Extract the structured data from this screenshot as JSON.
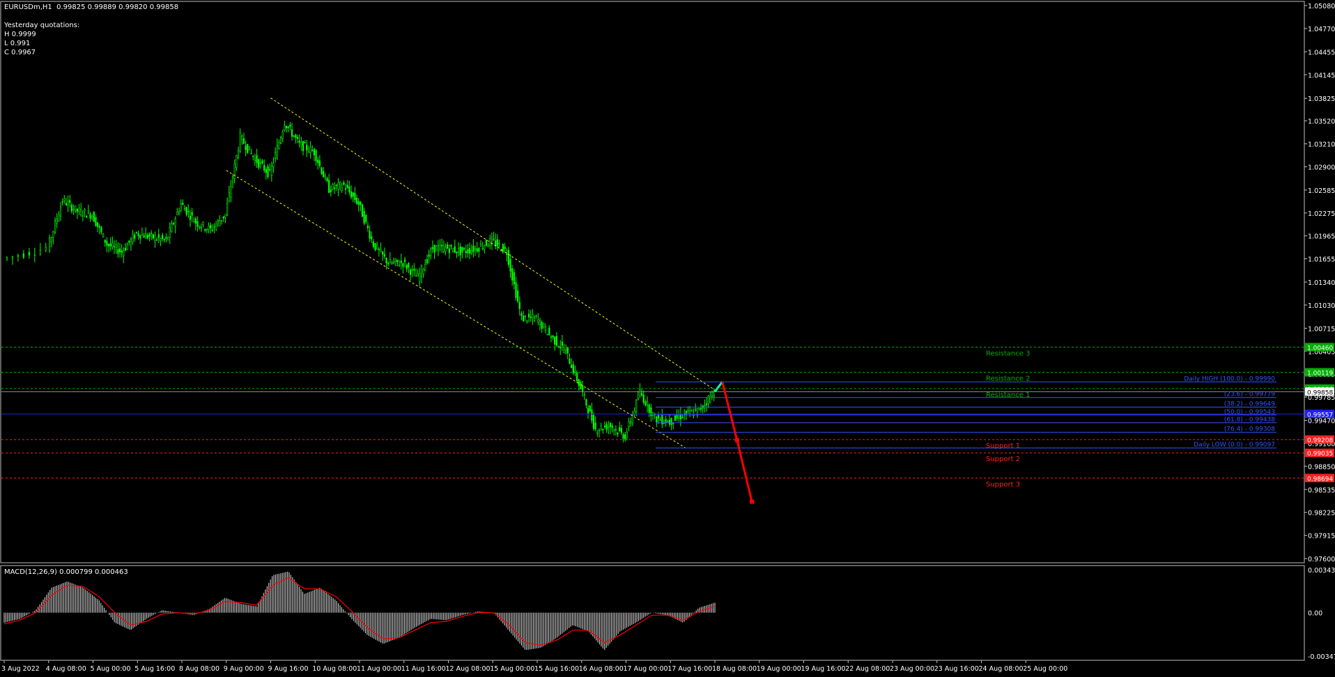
{
  "header": {
    "symbol_line": "EURUSDm,H1  0.99825 0.99889 0.99820 0.99858",
    "yesterday_title": "Yesterday quotations:",
    "high": "H 0.9999",
    "low": "L 0.991",
    "close": "C 0.9967"
  },
  "colors": {
    "background": "#000000",
    "candle": "#00ff00",
    "channel": "#ffff00",
    "resistance": "#00b000",
    "support": "#ff2020",
    "fib": "#3355ff",
    "forecast_up": "#00ffaa",
    "forecast_down": "#ff0000",
    "macd_hist": "#c0c0c0",
    "macd_signal": "#ff0000"
  },
  "price_axis": {
    "min": 0.976,
    "max": 1.0508,
    "ticks": [
      "1.05080",
      "1.04770",
      "1.04455",
      "1.04145",
      "1.03825",
      "1.03520",
      "1.03210",
      "1.02900",
      "1.02585",
      "1.02275",
      "1.01965",
      "1.01655",
      "1.01340",
      "1.01030",
      "1.00715",
      "1.00405",
      "1.00095",
      "0.99785",
      "0.99470",
      "0.99160",
      "0.98850",
      "0.98535",
      "0.98225",
      "0.97915",
      "0.97600"
    ]
  },
  "time_axis": {
    "labels": [
      "3 Aug 2022",
      "4 Aug 08:00",
      "5 Aug 00:00",
      "5 Aug 16:00",
      "8 Aug 08:00",
      "9 Aug 00:00",
      "9 Aug 16:00",
      "10 Aug 08:00",
      "11 Aug 00:00",
      "11 Aug 16:00",
      "12 Aug 08:00",
      "15 Aug 00:00",
      "15 Aug 16:00",
      "16 Aug 08:00",
      "17 Aug 00:00",
      "17 Aug 16:00",
      "18 Aug 08:00",
      "19 Aug 00:00",
      "19 Aug 16:00",
      "22 Aug 08:00",
      "23 Aug 00:00",
      "23 Aug 16:00",
      "24 Aug 08:00",
      "25 Aug 00:00"
    ]
  },
  "chart_data": {
    "type": "candlestick",
    "symbol": "EURUSDm",
    "timeframe": "H1",
    "close_path": [
      [
        "3 Aug 2022",
        1.0165
      ],
      [
        "4 Aug 00:00",
        1.018
      ],
      [
        "4 Aug 08:00",
        1.0245
      ],
      [
        "4 Aug 16:00",
        1.023
      ],
      [
        "5 Aug 00:00",
        1.0225
      ],
      [
        "5 Aug 08:00",
        1.0185
      ],
      [
        "5 Aug 16:00",
        1.0175
      ],
      [
        "8 Aug 00:00",
        1.02
      ],
      [
        "8 Aug 08:00",
        1.0195
      ],
      [
        "8 Aug 16:00",
        1.019
      ],
      [
        "9 Aug 00:00",
        1.024
      ],
      [
        "9 Aug 08:00",
        1.0215
      ],
      [
        "9 Aug 16:00",
        1.0205
      ],
      [
        "10 Aug 00:00",
        1.0225
      ],
      [
        "10 Aug 08:00",
        1.033
      ],
      [
        "10 Aug 16:00",
        1.03
      ],
      [
        "11 Aug 00:00",
        1.028
      ],
      [
        "11 Aug 08:00",
        1.035
      ],
      [
        "11 Aug 16:00",
        1.032
      ],
      [
        "12 Aug 00:00",
        1.031
      ],
      [
        "12 Aug 08:00",
        1.026
      ],
      [
        "12 Aug 16:00",
        1.0265
      ],
      [
        "15 Aug 00:00",
        1.024
      ],
      [
        "15 Aug 08:00",
        1.0185
      ],
      [
        "15 Aug 16:00",
        1.016
      ],
      [
        "16 Aug 00:00",
        1.016
      ],
      [
        "16 Aug 08:00",
        1.014
      ],
      [
        "16 Aug 16:00",
        1.018
      ],
      [
        "17 Aug 00:00",
        1.018
      ],
      [
        "17 Aug 08:00",
        1.0175
      ],
      [
        "17 Aug 16:00",
        1.018
      ],
      [
        "18 Aug 00:00",
        1.019
      ],
      [
        "18 Aug 08:00",
        1.0175
      ],
      [
        "18 Aug 16:00",
        1.0085
      ],
      [
        "19 Aug 00:00",
        1.0085
      ],
      [
        "19 Aug 08:00",
        1.006
      ],
      [
        "19 Aug 16:00",
        1.004
      ],
      [
        "22 Aug 00:00",
        0.999
      ],
      [
        "22 Aug 08:00",
        0.9935
      ],
      [
        "22 Aug 16:00",
        0.994
      ],
      [
        "23 Aug 00:00",
        0.9925
      ],
      [
        "23 Aug 08:00",
        0.9985
      ],
      [
        "23 Aug 16:00",
        0.995
      ],
      [
        "24 Aug 00:00",
        0.9945
      ],
      [
        "24 Aug 08:00",
        0.9955
      ],
      [
        "24 Aug 16:00",
        0.996
      ],
      [
        "25 Aug 00:00",
        0.9986
      ]
    ],
    "channel_lines": [
      {
        "from": [
          "11 Aug 00:00",
          1.0383
        ],
        "to": [
          "25 Aug 00:00",
          0.9988
        ]
      },
      {
        "from": [
          "10 Aug 00:00",
          1.0285
        ],
        "to": [
          "24 Aug 08:00",
          0.991
        ]
      }
    ],
    "levels": [
      {
        "name": "Resistance 3",
        "price_label": "1.00460",
        "price": 1.0046,
        "kind": "resistance"
      },
      {
        "name": "Resistance 2",
        "price_label": "1.00119",
        "price": 1.0012,
        "kind": "resistance"
      },
      {
        "name": "Resistance 1",
        "price_label": "0.99904",
        "price": 0.999,
        "kind": "resistance"
      },
      {
        "name": "Support 1",
        "price_label": "0.99208",
        "price": 0.9921,
        "kind": "support"
      },
      {
        "name": "Support 2",
        "price_label": "0.99035",
        "price": 0.9903,
        "kind": "support"
      },
      {
        "name": "Support 3",
        "price_label": "0.98694",
        "price": 0.9869,
        "kind": "support"
      }
    ],
    "current_price_label": "0.99858",
    "current_price": 0.99858,
    "pivot_label": "0.99557",
    "pivot_price": 0.99557,
    "fibonacci": [
      {
        "label": "Daily HIGH (100.0) -  0.99990",
        "price": 0.9999
      },
      {
        "label": "(23.6) -  0.99779",
        "price": 0.99779
      },
      {
        "label": "(38.2) -  0.99649",
        "price": 0.99649
      },
      {
        "label": "(50.0) -  0.99543",
        "price": 0.99543
      },
      {
        "label": "(61.8) -  0.99438",
        "price": 0.99438
      },
      {
        "label": "(76.4) -  0.99308",
        "price": 0.99308
      },
      {
        "label": "Daily LOW (0.0) -  0.99097",
        "price": 0.99097
      }
    ],
    "forecast": [
      [
        "25 Aug 00:00",
        0.99858
      ],
      [
        "25 Aug 04:00",
        0.9999
      ],
      [
        "25 Aug 12:00",
        0.992
      ],
      [
        "25 Aug 20:00",
        0.9837
      ]
    ]
  },
  "macd": {
    "title": "MACD(12,26,9) 0.000799 0.000463",
    "ticks": [
      "0.003435",
      "0.00",
      "-0.003476"
    ],
    "min": -0.003476,
    "max": 0.003435,
    "hist": [
      -0.0008,
      -0.0005,
      0.0002,
      0.002,
      0.0025,
      0.002,
      0.001,
      -0.0008,
      -0.0014,
      -0.0005,
      0.0002,
      0.0,
      -0.0002,
      0.0003,
      0.0012,
      0.0007,
      0.0005,
      0.003,
      0.0033,
      0.0015,
      0.002,
      0.001,
      -0.0005,
      -0.0018,
      -0.0025,
      -0.002,
      -0.0012,
      -0.0005,
      -0.0006,
      -0.0002,
      0.0001,
      0.0,
      -0.0015,
      -0.003,
      -0.0028,
      -0.002,
      -0.001,
      -0.0015,
      -0.003,
      -0.0015,
      -0.0008,
      0.0,
      -0.0002,
      -0.0008,
      0.0004,
      0.0008
    ],
    "signal": [
      -0.0009,
      -0.0006,
      0.0,
      0.0014,
      0.0022,
      0.0021,
      0.0013,
      0.0,
      -0.001,
      -0.0007,
      -0.0001,
      0.0,
      -0.0001,
      0.0002,
      0.0009,
      0.0008,
      0.0006,
      0.0022,
      0.0028,
      0.0019,
      0.0019,
      0.0013,
      0.0001,
      -0.0012,
      -0.0021,
      -0.002,
      -0.0014,
      -0.0008,
      -0.0007,
      -0.0003,
      0.0,
      0.0,
      -0.001,
      -0.0024,
      -0.0026,
      -0.0022,
      -0.0014,
      -0.0014,
      -0.0024,
      -0.0018,
      -0.001,
      -0.0002,
      -0.0002,
      -0.0006,
      0.0001,
      0.0005
    ]
  }
}
